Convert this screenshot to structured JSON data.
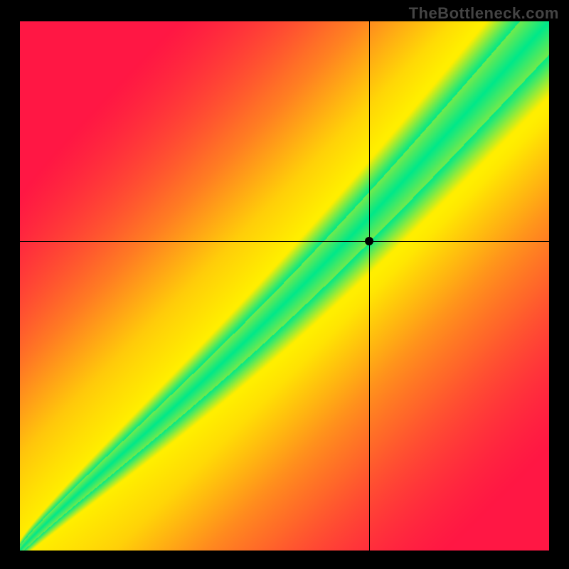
{
  "watermark": "TheBottleneck.com",
  "chart_data": {
    "type": "heatmap",
    "title": "",
    "xlabel": "",
    "ylabel": "",
    "xlim": [
      0,
      1
    ],
    "ylim": [
      0,
      1
    ],
    "marker": {
      "x": 0.66,
      "y": 0.585
    },
    "crosshair": {
      "x": 0.66,
      "y": 0.585
    },
    "grid": false,
    "legend": false,
    "description": "Heatmap gradient from red (mismatch) through yellow to green (optimal) along a diagonal band; crosshair and black dot mark a selected point on the upper portion of the band.",
    "color_stops": {
      "mismatch": "#ff1744",
      "warn": "#ffee00",
      "optimal": "#00e88a"
    }
  },
  "colors": {
    "background": "#000000",
    "watermark": "#444444",
    "crosshair": "#000000",
    "marker": "#000000"
  }
}
